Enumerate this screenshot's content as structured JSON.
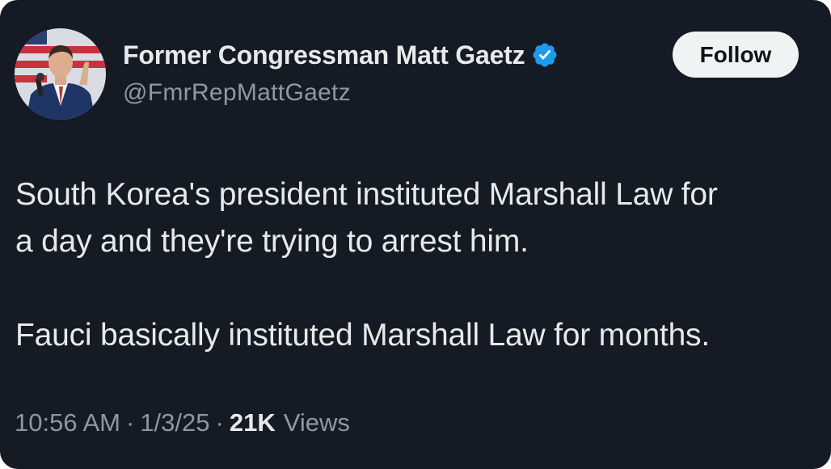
{
  "author": {
    "display_name": "Former Congressman Matt Gaetz",
    "handle": "@FmrRepMattGaetz",
    "verified": true,
    "verified_badge_color": "#1d9bf0"
  },
  "follow_button": {
    "label": "Follow"
  },
  "tweet": {
    "paragraph_1_line_1": "South Korea's president instituted Marshall Law for",
    "paragraph_1_line_2": "a day and they're trying to arrest him.",
    "paragraph_2": "Fauci basically instituted Marshall Law for months."
  },
  "meta": {
    "time": "10:56 AM",
    "separator": "·",
    "date": "1/3/25",
    "views_count": "21K",
    "views_label": "Views"
  },
  "colors": {
    "background": "#151b24",
    "text_primary": "#e7e9ea",
    "text_secondary": "#8b98a5",
    "button_bg": "#eff3f4"
  }
}
